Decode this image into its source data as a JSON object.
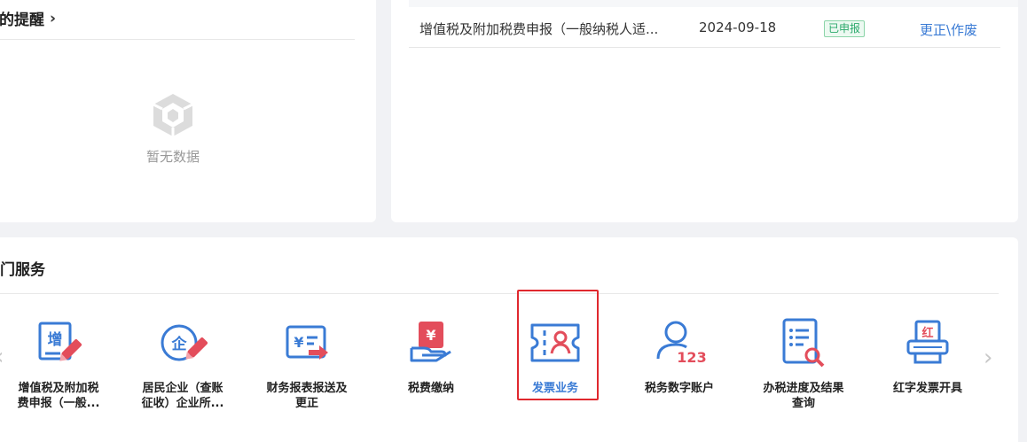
{
  "reminder": {
    "title": "我的提醒",
    "empty_text": "暂无数据"
  },
  "filing": {
    "rows": [
      {
        "name": "增值税及附加税费申报（一般纳税人适...",
        "date": "2024-09-18",
        "status": "已申报",
        "action": "更正\\作废"
      }
    ]
  },
  "hot_services": {
    "title": "热门服务",
    "items": [
      {
        "label_line1": "增值税及附加税",
        "label_line2": "费申报（一般...",
        "icon": "vat-filing-icon"
      },
      {
        "label_line1": "居民企业（查账",
        "label_line2": "征收）企业所...",
        "icon": "enterprise-income-tax-icon"
      },
      {
        "label_line1": "财务报表报送及",
        "label_line2": "更正",
        "icon": "financial-report-icon"
      },
      {
        "label_line1": "税费缴纳",
        "label_line2": "",
        "icon": "tax-payment-icon"
      },
      {
        "label_line1": "发票业务",
        "label_line2": "",
        "icon": "invoice-business-icon"
      },
      {
        "label_line1": "税务数字账户",
        "label_line2": "",
        "icon": "digital-tax-account-icon"
      },
      {
        "label_line1": "办税进度及结果",
        "label_line2": "查询",
        "icon": "progress-query-icon"
      },
      {
        "label_line1": "红字发票开具",
        "label_line2": "",
        "icon": "red-invoice-icon"
      }
    ],
    "selected_index": 4
  },
  "colors": {
    "accent_blue": "#3a7bd5",
    "accent_red": "#e34d5b",
    "highlight_red": "#e0282e",
    "status_green": "#2ba96b"
  }
}
